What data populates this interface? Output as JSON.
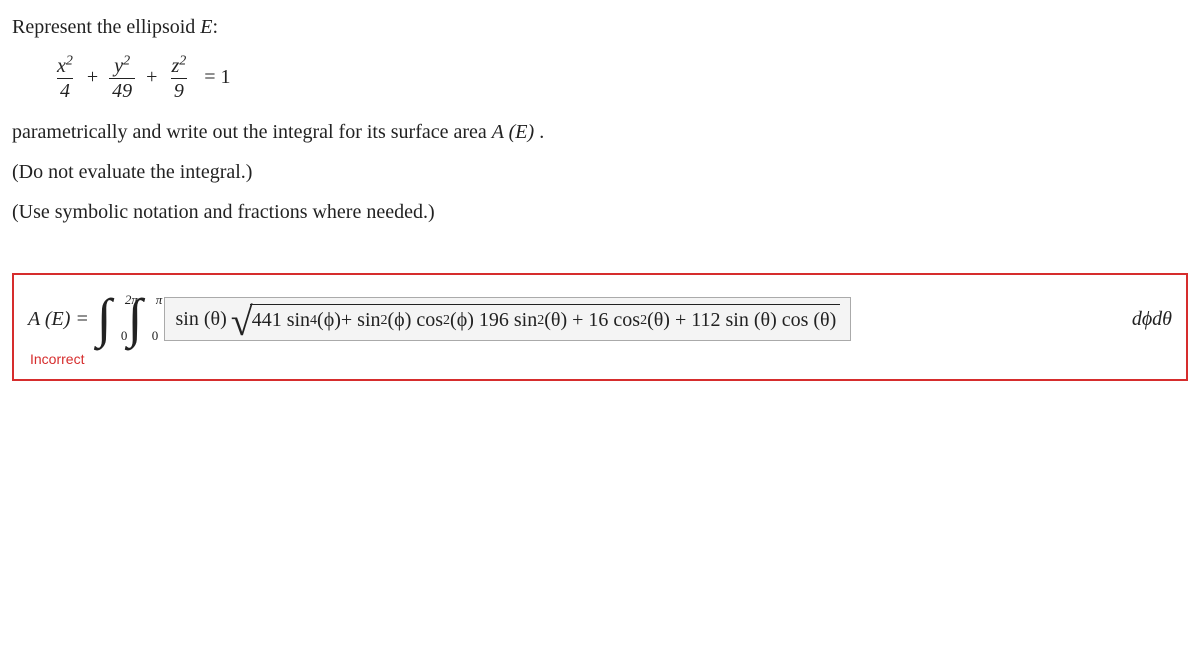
{
  "prompt": {
    "line1_pre": "Represent the ellipsoid ",
    "line1_E": "E",
    "line1_post": ":",
    "eq_x_num": "x",
    "eq_x_den": "4",
    "eq_y_num": "y",
    "eq_y_den": "49",
    "eq_z_num": "z",
    "eq_z_den": "9",
    "eq_rhs": "= 1",
    "plus": "+",
    "line2_pre": "parametrically and write out the integral for its surface area ",
    "line2_AE": "A (E)",
    "line2_post": " .",
    "line3": "(Do not evaluate the integral.)",
    "line4": "(Use symbolic notation and fractions where needed.)"
  },
  "answer": {
    "lhs": "A (E) = ",
    "outer_upper": "2π",
    "outer_lower": "0",
    "inner_upper": "π",
    "inner_lower": "0",
    "integrand_lead": "sin (θ)",
    "rad_t1_coef": "441 sin",
    "rad_t1_exp": "4",
    "rad_t1_arg": " (ϕ) ",
    "rad_plus1": "+ sin",
    "rad_t2_exp": "2",
    "rad_t2_arg": " (ϕ) cos",
    "rad_t3_exp": "2",
    "rad_t3_arg": " (ϕ) 196 sin",
    "rad_t4_exp": "2",
    "rad_t4_arg": " (θ)  + 16 cos",
    "rad_t5_exp": "2",
    "rad_t5_arg": " (θ) + 112 sin (θ) cos (θ)",
    "differentials": "dϕdθ"
  },
  "feedback": "Incorrect"
}
